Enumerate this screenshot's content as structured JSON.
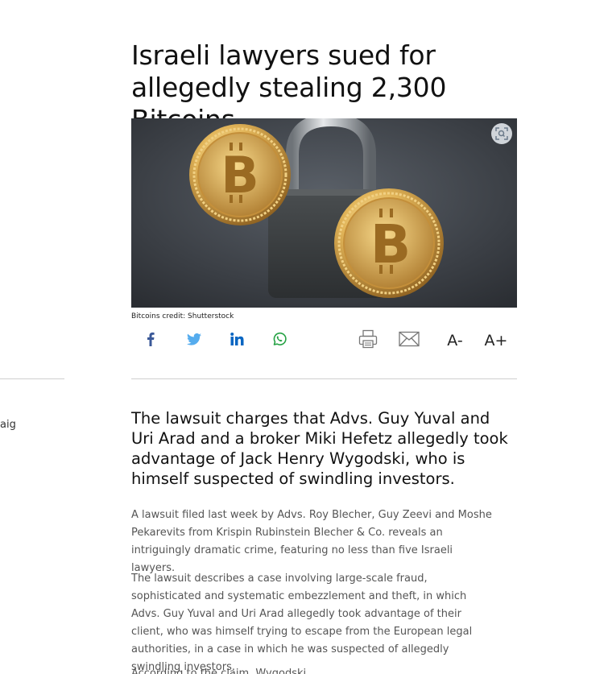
{
  "sidebar": {
    "partial_text": "aig"
  },
  "article": {
    "title": "Israeli lawyers sued for allegedly stealing 2,300 Bitcoins",
    "image_caption": "Bitcoins credit: Shutterstock",
    "lead": "The lawsuit charges that Advs. Guy Yuval and Uri Arad and a broker Miki Hefetz allegedly took advantage of Jack Henry Wygodski, who is himself suspected of swindling investors.",
    "paragraphs": [
      "A lawsuit filed last week by Advs. Roy Blecher, Guy Zeevi and Moshe Pekarevits from Krispin Rubinstein Blecher & Co. reveals an intriguingly dramatic crime, featuring no less than five Israeli lawyers.",
      "The lawsuit describes a case involving large-scale fraud, sophisticated and systematic embezzlement and theft, in which Advs. Guy Yuval and Uri Arad allegedly took advantage of their client, who was himself trying to escape from the European legal authorities, in a case in which he was suspected of allegedly swindling investors.",
      "According to the claim, Wygodski..."
    ]
  },
  "toolbar": {
    "font_decrease_label": "A-",
    "font_increase_label": "A+"
  },
  "icons": {
    "facebook": "facebook-icon",
    "twitter": "twitter-icon",
    "linkedin": "linkedin-icon",
    "whatsapp": "whatsapp-icon",
    "print": "print-icon",
    "email": "mail-icon",
    "zoom": "zoom-icon"
  },
  "colors": {
    "facebook": "#3b5998",
    "twitter": "#55acee",
    "linkedin": "#0a66c2",
    "whatsapp": "#25a244",
    "icon_gray": "#777777"
  }
}
